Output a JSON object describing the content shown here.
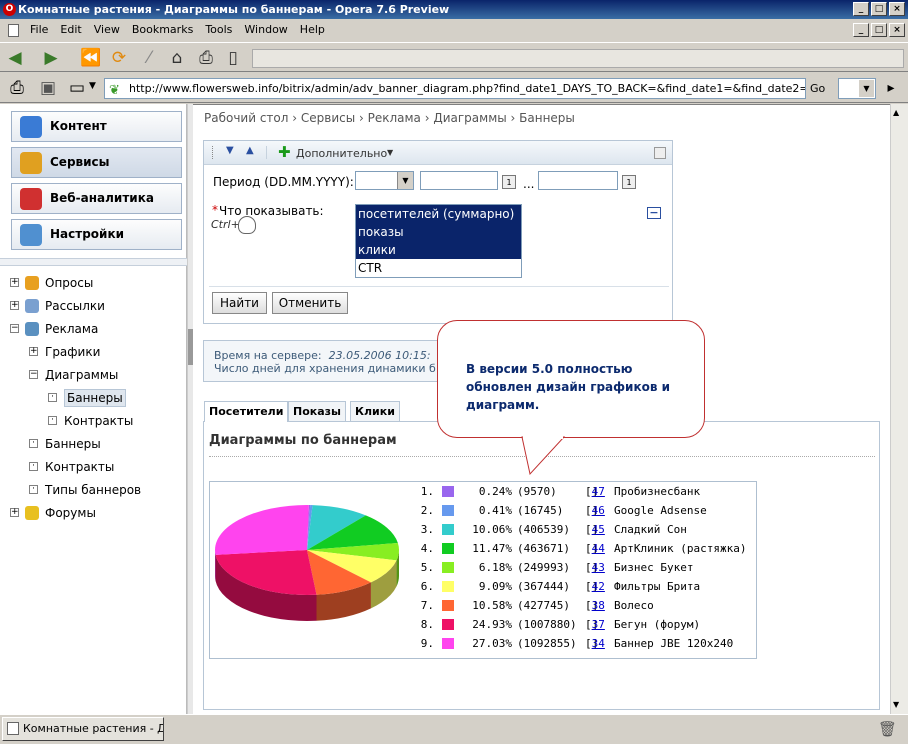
{
  "window": {
    "title": "Комнатные растения - Диаграммы по баннерам - Opera 7.6 Preview"
  },
  "menu": [
    "File",
    "Edit",
    "View",
    "Bookmarks",
    "Tools",
    "Window",
    "Help"
  ],
  "address": {
    "url": "http://www.flowersweb.info/bitrix/admin/adv_banner_diagram.php?find_date1_DAYS_TO_BACK=&find_date1=&find_date2=&find_what",
    "go_label": "Go"
  },
  "sidebar": {
    "main_buttons": [
      {
        "label": "Контент",
        "icon": "content-icon",
        "color": "#3a7bd5"
      },
      {
        "label": "Сервисы",
        "icon": "services-icon",
        "color": "#e0a020"
      },
      {
        "label": "Веб-аналитика",
        "icon": "analytics-icon",
        "color": "#d03030"
      },
      {
        "label": "Настройки",
        "icon": "settings-icon",
        "color": "#5090d0"
      }
    ],
    "tree": [
      {
        "label": "Опросы",
        "level": 0,
        "toggle": "+"
      },
      {
        "label": "Рассылки",
        "level": 0,
        "toggle": "+"
      },
      {
        "label": "Реклама",
        "level": 0,
        "toggle": "−"
      },
      {
        "label": "Графики",
        "level": 1,
        "toggle": "+"
      },
      {
        "label": "Диаграммы",
        "level": 1,
        "toggle": "−"
      },
      {
        "label": "Баннеры",
        "level": 2,
        "toggle": "·",
        "selected": true
      },
      {
        "label": "Контракты",
        "level": 2,
        "toggle": "·"
      },
      {
        "label": "Баннеры",
        "level": 1,
        "toggle": "·"
      },
      {
        "label": "Контракты",
        "level": 1,
        "toggle": "·"
      },
      {
        "label": "Типы баннеров",
        "level": 1,
        "toggle": "·"
      },
      {
        "label": "Форумы",
        "level": 0,
        "toggle": "+"
      }
    ]
  },
  "breadcrumb": "Рабочий стол › Сервисы › Реклама › Диаграммы › Баннеры",
  "filter": {
    "more_label": "Дополнительно",
    "period_label": "Период (DD.MM.YYYY):",
    "period_sep": "...",
    "calendar_label": "1",
    "what_label": "Что показывать:",
    "required_mark": "*",
    "ctrl_hint": "Ctrl+",
    "options": [
      {
        "label": "посетителей (суммарно)",
        "selected": true
      },
      {
        "label": "показы",
        "selected": true
      },
      {
        "label": "клики",
        "selected": true
      },
      {
        "label": "CTR",
        "selected": false
      }
    ],
    "find_label": "Найти",
    "cancel_label": "Отменить"
  },
  "info": {
    "server_time_label": "Время на сервере:",
    "server_time": "23.05.2006 10:15:",
    "days_label": "Число дней для хранения динамики б"
  },
  "callout": {
    "text": "В версии 5.0 полностью обновлен дизайн графиков и диаграмм."
  },
  "tabs": [
    "Посетители",
    "Показы",
    "Клики"
  ],
  "chart_title": "Диаграммы по баннерам",
  "chart_data": {
    "type": "pie",
    "slices": [
      {
        "idx": "1.",
        "percent": "0.24%",
        "count": "(9570)",
        "id": "[47]",
        "name": "Пробизнесбанк",
        "value": 0.24,
        "color": "#9966ee"
      },
      {
        "idx": "2.",
        "percent": "0.41%",
        "count": "(16745)",
        "id": "[46]",
        "name": "Google Adsense",
        "value": 0.41,
        "color": "#6699ee"
      },
      {
        "idx": "3.",
        "percent": "10.06%",
        "count": "(406539)",
        "id": "[45]",
        "name": "Сладкий Сон",
        "value": 10.06,
        "color": "#33cccc"
      },
      {
        "idx": "4.",
        "percent": "11.47%",
        "count": "(463671)",
        "id": "[44]",
        "name": "АртКлиник (растяжка)",
        "value": 11.47,
        "color": "#11cc22"
      },
      {
        "idx": "5.",
        "percent": "6.18%",
        "count": "(249993)",
        "id": "[43]",
        "name": "Бизнес Букет",
        "value": 6.18,
        "color": "#88ee22"
      },
      {
        "idx": "6.",
        "percent": "9.09%",
        "count": "(367444)",
        "id": "[42]",
        "name": "Фильтры Брита",
        "value": 9.09,
        "color": "#ffff66"
      },
      {
        "idx": "7.",
        "percent": "10.58%",
        "count": "(427745)",
        "id": "[38]",
        "name": "Волесо",
        "value": 10.58,
        "color": "#ff6633"
      },
      {
        "idx": "8.",
        "percent": "24.93%",
        "count": "(1007880)",
        "id": "[37]",
        "name": "Бегун (форум)",
        "value": 24.93,
        "color": "#ee1166"
      },
      {
        "idx": "9.",
        "percent": "27.03%",
        "count": "(1092855)",
        "id": "[34]",
        "name": "Баннер JBE 120x240",
        "value": 27.03,
        "color": "#ff44ee"
      }
    ]
  },
  "taskbar": {
    "label": "Комнатные растения - Д..."
  }
}
